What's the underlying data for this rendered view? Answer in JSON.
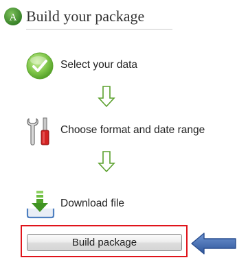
{
  "header": {
    "badge_letter": "A",
    "title": "Build your package"
  },
  "steps": [
    {
      "label": "Select your data",
      "icon": "checkmark-circle-icon"
    },
    {
      "label": "Choose format and date range",
      "icon": "tools-icon"
    },
    {
      "label": "Download file",
      "icon": "download-icon"
    }
  ],
  "flow_arrow_icon": "down-arrow-outline-icon",
  "build_button": {
    "label": "Build package"
  },
  "pointer_icon": "left-pointing-arrow-icon",
  "colors": {
    "badge_green": "#3f8a2c",
    "highlight_red": "#e0141b",
    "arrow_blue": "#3a62a7",
    "flow_arrow_green": "#5aa02c"
  }
}
